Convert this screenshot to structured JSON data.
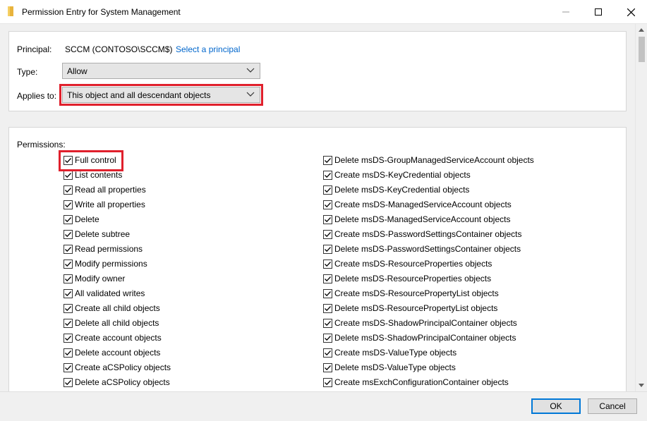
{
  "window": {
    "title": "Permission Entry for System Management",
    "minimize_icon": "minimize-icon",
    "maximize_icon": "maximize-icon",
    "close_icon": "close-icon"
  },
  "principal": {
    "label": "Principal:",
    "value": "SCCM (CONTOSO\\SCCM$)",
    "link": "Select a principal"
  },
  "type": {
    "label": "Type:",
    "value": "Allow"
  },
  "applies_to": {
    "label": "Applies to:",
    "value": "This object and all descendant objects"
  },
  "permissions": {
    "label": "Permissions:",
    "left": [
      {
        "label": "Full control",
        "checked": true
      },
      {
        "label": "List contents",
        "checked": true
      },
      {
        "label": "Read all properties",
        "checked": true
      },
      {
        "label": "Write all properties",
        "checked": true
      },
      {
        "label": "Delete",
        "checked": true
      },
      {
        "label": "Delete subtree",
        "checked": true
      },
      {
        "label": "Read permissions",
        "checked": true
      },
      {
        "label": "Modify permissions",
        "checked": true
      },
      {
        "label": "Modify owner",
        "checked": true
      },
      {
        "label": "All validated writes",
        "checked": true
      },
      {
        "label": "Create all child objects",
        "checked": true
      },
      {
        "label": "Delete all child objects",
        "checked": true
      },
      {
        "label": "Create account objects",
        "checked": true
      },
      {
        "label": "Delete account objects",
        "checked": true
      },
      {
        "label": "Create aCSPolicy objects",
        "checked": true
      },
      {
        "label": "Delete aCSPolicy objects",
        "checked": true
      }
    ],
    "right": [
      {
        "label": "Delete msDS-GroupManagedServiceAccount objects",
        "checked": true
      },
      {
        "label": "Create msDS-KeyCredential objects",
        "checked": true
      },
      {
        "label": "Delete msDS-KeyCredential objects",
        "checked": true
      },
      {
        "label": "Create msDS-ManagedServiceAccount objects",
        "checked": true
      },
      {
        "label": "Delete msDS-ManagedServiceAccount objects",
        "checked": true
      },
      {
        "label": "Create msDS-PasswordSettingsContainer objects",
        "checked": true
      },
      {
        "label": "Delete msDS-PasswordSettingsContainer objects",
        "checked": true
      },
      {
        "label": "Create msDS-ResourceProperties objects",
        "checked": true
      },
      {
        "label": "Delete msDS-ResourceProperties objects",
        "checked": true
      },
      {
        "label": "Create msDS-ResourcePropertyList objects",
        "checked": true
      },
      {
        "label": "Delete msDS-ResourcePropertyList objects",
        "checked": true
      },
      {
        "label": "Create msDS-ShadowPrincipalContainer objects",
        "checked": true
      },
      {
        "label": "Delete msDS-ShadowPrincipalContainer objects",
        "checked": true
      },
      {
        "label": "Create msDS-ValueType objects",
        "checked": true
      },
      {
        "label": "Delete msDS-ValueType objects",
        "checked": true
      },
      {
        "label": "Create msExchConfigurationContainer objects",
        "checked": true
      }
    ]
  },
  "footer": {
    "ok_label": "OK",
    "cancel_label": "Cancel"
  },
  "colors": {
    "highlight": "#e0202c",
    "link": "#0066cc",
    "focus_border": "#0078d7"
  }
}
